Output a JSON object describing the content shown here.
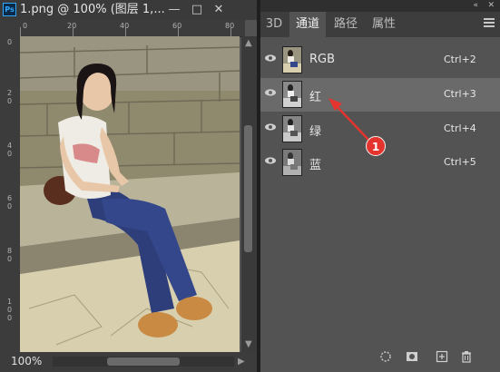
{
  "document": {
    "app_icon_label": "Ps",
    "tab_title": "1.png @ 100% (图层 1,...",
    "minimize_label": "—",
    "maximize_label": "□",
    "close_label": "✕",
    "ruler_h": [
      "0",
      "20",
      "40",
      "60",
      "80"
    ],
    "ruler_v": [
      [
        "0"
      ],
      [
        "2",
        "0"
      ],
      [
        "4",
        "0"
      ],
      [
        "6",
        "0"
      ],
      [
        "8",
        "0"
      ],
      [
        "1",
        "0",
        "0"
      ]
    ],
    "zoom": "100%"
  },
  "panel": {
    "collapse_label": "«",
    "close_label": "✕",
    "tabs": [
      "3D",
      "通道",
      "路径",
      "属性"
    ],
    "active_tab": 1,
    "channels": [
      {
        "name": "RGB",
        "shortcut": "Ctrl+2"
      },
      {
        "name": "红",
        "shortcut": "Ctrl+3",
        "selected": true
      },
      {
        "name": "绿",
        "shortcut": "Ctrl+4"
      },
      {
        "name": "蓝",
        "shortcut": "Ctrl+5"
      }
    ],
    "bottom_icons": [
      "load-selection-icon",
      "save-selection-icon",
      "new-channel-icon",
      "delete-channel-icon"
    ]
  },
  "annotation": {
    "badge_number": "1",
    "badge_color": "#e5342e"
  }
}
